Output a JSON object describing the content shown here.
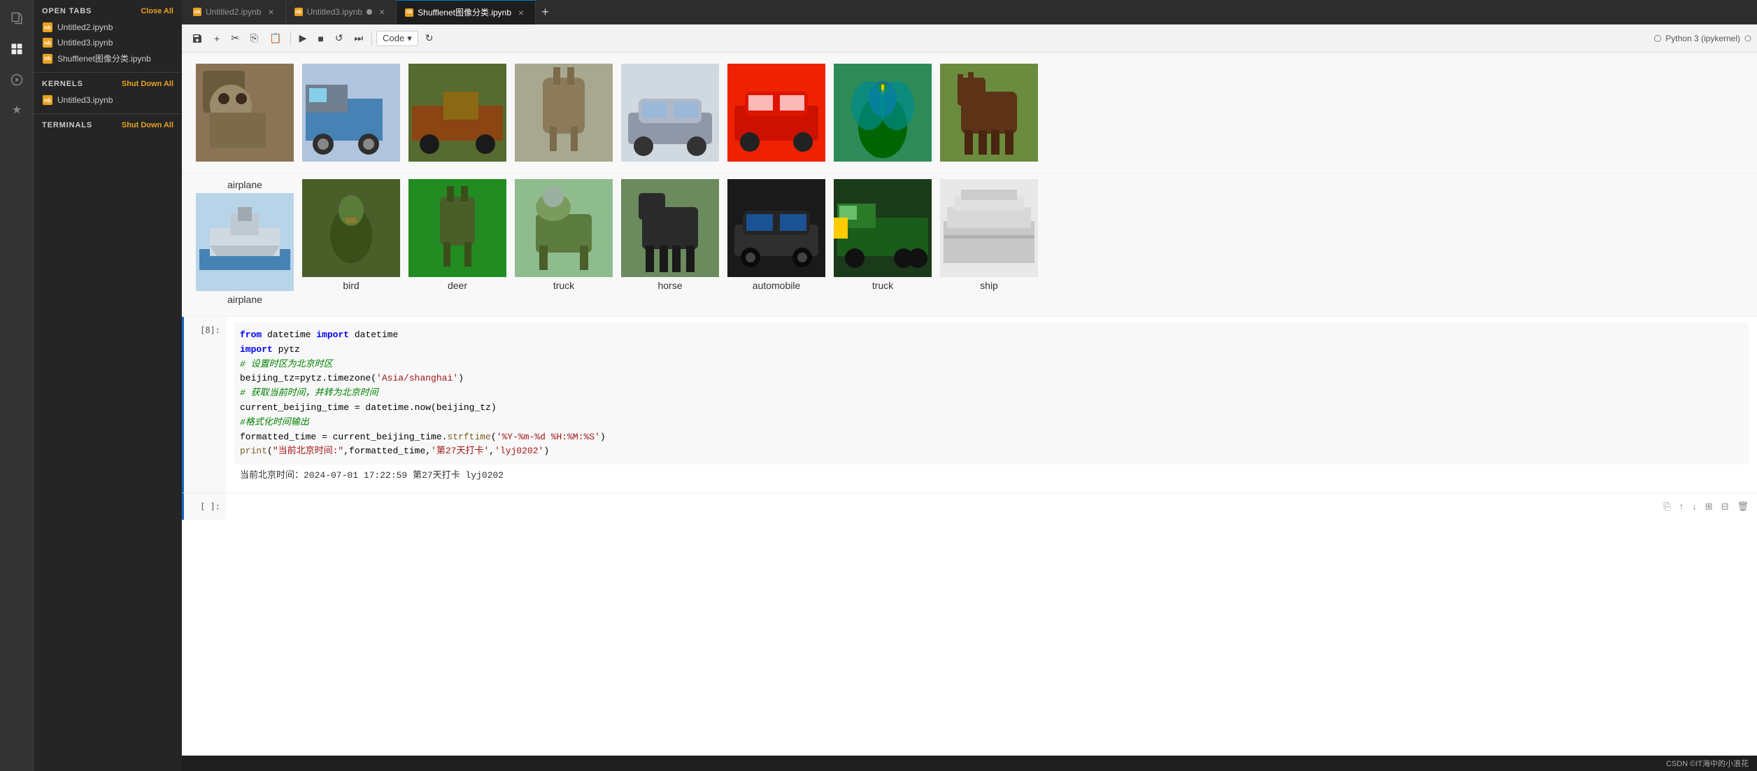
{
  "sidebar": {
    "open_tabs_label": "OPEN TABS",
    "close_all_label": "Close All",
    "kernels_label": "KERNELS",
    "shut_down_all_kernels_label": "Shut Down All",
    "terminals_label": "TERMINALS",
    "shut_down_all_terminals_label": "Shut Down All",
    "files": [
      {
        "name": "Untitled2.ipynb"
      },
      {
        "name": "Untitled3.ipynb"
      },
      {
        "name": "Shufflenet图像分类.ipynb"
      }
    ],
    "kernels": [
      {
        "name": "Untitled3.ipynb"
      }
    ]
  },
  "tabs": [
    {
      "label": "Untitled2.ipynb",
      "active": false,
      "has_dot": false
    },
    {
      "label": "Untitled3.ipynb",
      "active": false,
      "has_dot": true
    },
    {
      "label": "Shufflenet图像分类.ipynb",
      "active": true,
      "has_dot": false
    }
  ],
  "toolbar": {
    "code_type": "Code",
    "kernel_info": "Python 3 (ipykernel)"
  },
  "image_rows": [
    {
      "images": [
        {
          "label": "",
          "color1": "#8B7355",
          "color2": "#6B5B3E",
          "type": "animal"
        },
        {
          "label": "",
          "color1": "#708090",
          "color2": "#4682B4",
          "type": "truck"
        },
        {
          "label": "",
          "color1": "#556B2F",
          "color2": "#8B4513",
          "type": "truck2"
        },
        {
          "label": "",
          "color1": "#8B8B6B",
          "color2": "#9B9B7B",
          "type": "deer"
        },
        {
          "label": "",
          "color1": "#C0C8D0",
          "color2": "#8090A0",
          "type": "car"
        },
        {
          "label": "",
          "color1": "#CC2200",
          "color2": "#AA1100",
          "type": "redcar"
        },
        {
          "label": "",
          "color1": "#228B22",
          "color2": "#006400",
          "type": "bird"
        },
        {
          "label": "",
          "color1": "#5C3317",
          "color2": "#8B4513",
          "type": "horse"
        }
      ]
    },
    {
      "images": [
        {
          "label": "airplane",
          "color1": "#87CEEB",
          "color2": "#B0E0E6",
          "type": "boat"
        },
        {
          "label": "bird",
          "color1": "#556B2F",
          "color2": "#6B8E23",
          "type": "bird2"
        },
        {
          "label": "deer",
          "color1": "#228B22",
          "color2": "#355E23",
          "type": "deer2"
        },
        {
          "label": "truck",
          "color1": "#8FBC8F",
          "color2": "#7B9B7B",
          "type": "truck3"
        },
        {
          "label": "horse",
          "color1": "#4A4A4A",
          "color2": "#2A2A2A",
          "type": "horse2"
        },
        {
          "label": "automobile",
          "color1": "#2F2F2F",
          "color2": "#1A1A1A",
          "type": "car2"
        },
        {
          "label": "truck",
          "color1": "#1A5C1A",
          "color2": "#FFCC00",
          "type": "truck4"
        },
        {
          "label": "ship",
          "color1": "#C8C8C8",
          "color2": "#E0E0E0",
          "type": "ship"
        }
      ]
    }
  ],
  "code_cell": {
    "number": "[8]:",
    "lines": [
      {
        "type": "code",
        "content": "from datetime import datetime"
      },
      {
        "type": "code",
        "content": "import pytz"
      },
      {
        "type": "comment",
        "content": "# 设置时区为北京时区"
      },
      {
        "type": "code",
        "content": "beijing_tz=pytz.timezone('Asia/shanghai')"
      },
      {
        "type": "comment",
        "content": "# 获取当前时间，并转为北京时间"
      },
      {
        "type": "code",
        "content": "current_beijing_time = datetime.now(beijing_tz)"
      },
      {
        "type": "comment",
        "content": "#格式化时间输出"
      },
      {
        "type": "code",
        "content": "formatted_time = current_beijing_time.strftime('%Y-%m-%d %H:%M:%S')"
      },
      {
        "type": "code",
        "content": "print(\"当前北京时间:\",formatted_time,'第27天打卡','lyj0202')"
      }
    ],
    "output": "当前北京时间：2024-07-01 17:22:59 第27天打卡 lyj0202"
  },
  "empty_cell": {
    "number": "[ ]:"
  },
  "bottom_bar": {
    "text": "CSDN ©IT海中的小浪花"
  }
}
